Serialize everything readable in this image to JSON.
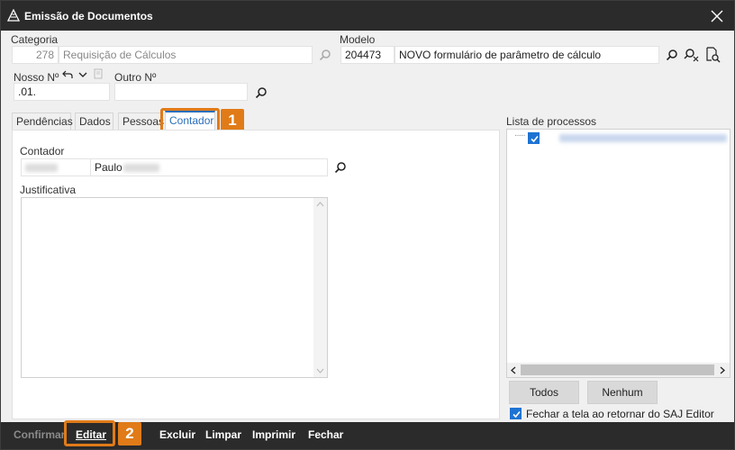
{
  "window": {
    "title": "Emissão de Documentos",
    "icon": "app-triangle-icon",
    "close_icon": "close-icon"
  },
  "header": {
    "categoria": {
      "label": "Categoria",
      "code": "278",
      "value": "Requisição de Cálculos"
    },
    "modelo": {
      "label": "Modelo",
      "code": "204473",
      "value": "NOVO formulário de parâmetro de cálculo"
    },
    "nosso_numero": {
      "label": "Nosso Nº",
      "value": ".01."
    },
    "outro_numero": {
      "label": "Outro Nº",
      "value": ""
    }
  },
  "tabs": [
    {
      "label": "Pendências"
    },
    {
      "label": "Dados"
    },
    {
      "label": "Pessoas"
    },
    {
      "label": "Contador",
      "active": true
    }
  ],
  "contador_panel": {
    "contador_label": "Contador",
    "contador_name": "Paulo",
    "justificativa_label": "Justificativa",
    "justificativa_value": ""
  },
  "processes": {
    "label": "Lista de processos",
    "tree_prefix": "·····",
    "buttons": {
      "todos": "Todos",
      "nenhum": "Nenhum"
    },
    "close_on_return_label": "Fechar a tela ao retornar do SAJ Editor"
  },
  "annotations": {
    "one": "1",
    "two": "2"
  },
  "bottom_bar": {
    "confirmar": "Confirmar",
    "editar": "Editar",
    "excluir": "Excluir",
    "limpar": "Limpar",
    "imprimir": "Imprimir",
    "fechar": "Fechar"
  },
  "colors": {
    "accent": "#2a6ebb",
    "callout": "#e07b18",
    "titlebar": "#2b2b2b",
    "checkbox": "#1e73d2"
  }
}
